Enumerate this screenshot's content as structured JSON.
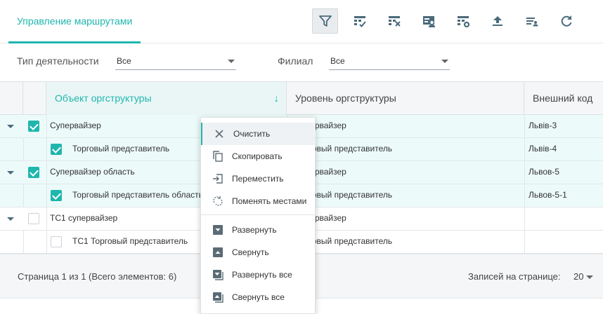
{
  "header": {
    "title": "Управление маршрутами"
  },
  "toolbar": [
    {
      "name": "filter-icon",
      "active": true
    },
    {
      "name": "table-check-icon"
    },
    {
      "name": "table-remove-icon"
    },
    {
      "name": "user-card-icon"
    },
    {
      "name": "table-settings-icon"
    },
    {
      "name": "upload-icon"
    },
    {
      "name": "list-user-icon"
    },
    {
      "name": "refresh-icon"
    }
  ],
  "filters": {
    "activity_label": "Тип деятельности",
    "activity_value": "Все",
    "branch_label": "Филиал",
    "branch_value": "Все"
  },
  "grid": {
    "columns": [
      "Объект оргструктуры",
      "Уровень оргструктуры",
      "Внешний код"
    ],
    "sort_icon": "arrow-down-icon",
    "rows": [
      {
        "object": "Супервайзер",
        "level": "Супервайзер",
        "code": "Львів-3",
        "checked": true,
        "expandable": true,
        "child": false
      },
      {
        "object": "Торговый представитель",
        "level": "Торговый представитель",
        "code": "Львів-4",
        "checked": true,
        "expandable": false,
        "child": true
      },
      {
        "object": "Супервайзер область",
        "level": "Супервайзер",
        "code": "Львов-5",
        "checked": true,
        "expandable": true,
        "child": false
      },
      {
        "object": "Торговый представитель область",
        "level": "Торговый представитель",
        "code": "Львов-5-1",
        "checked": true,
        "expandable": false,
        "child": true
      },
      {
        "object": "ТС1 супервайзер",
        "level": "Супервайзер",
        "code": "",
        "checked": false,
        "expandable": true,
        "child": false
      },
      {
        "object": "ТС1 Торговый представитель",
        "level": "Торговый представитель",
        "code": "",
        "checked": false,
        "expandable": false,
        "child": true
      }
    ]
  },
  "footer": {
    "page_info": "Страница 1 из 1 (Всего элементов: 6)",
    "page_size_label": "Записей на странице:",
    "page_size": "20"
  },
  "context_menu": {
    "items": [
      {
        "label": "Очистить",
        "icon": "close-icon"
      },
      {
        "label": "Скопировать",
        "icon": "copy-icon"
      },
      {
        "label": "Переместить",
        "icon": "move-icon"
      },
      {
        "label": "Поменять местами",
        "icon": "swap-icon"
      },
      {
        "label": "Развернуть",
        "icon": "expand-icon"
      },
      {
        "label": "Свернуть",
        "icon": "collapse-icon"
      },
      {
        "label": "Развернуть все",
        "icon": "expand-all-icon"
      },
      {
        "label": "Свернуть все",
        "icon": "collapse-all-icon"
      }
    ]
  }
}
